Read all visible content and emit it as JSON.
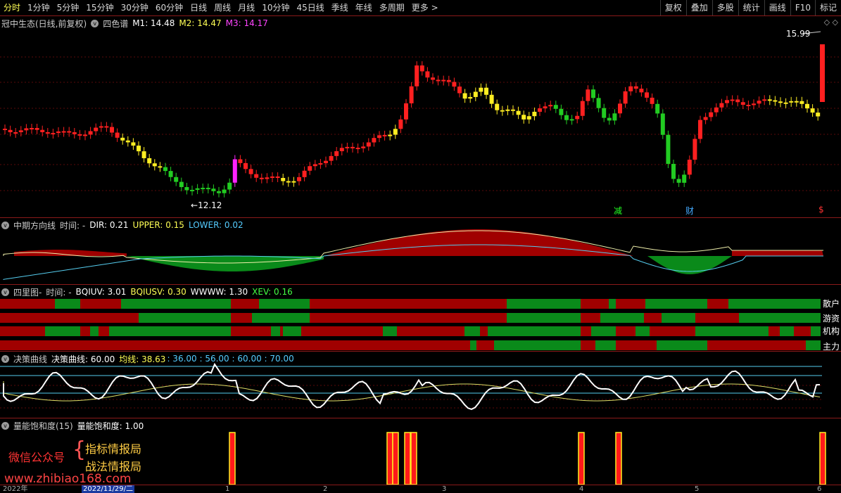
{
  "toolbar": {
    "periods": [
      "分时",
      "1分钟",
      "5分钟",
      "15分钟",
      "30分钟",
      "60分钟",
      "日线",
      "周线",
      "月线",
      "10分钟",
      "45日线",
      "季线",
      "年线",
      "多周期",
      "更多 >"
    ],
    "active_index": 0,
    "right_tools": [
      "复权",
      "叠加",
      "多股",
      "统计",
      "画线",
      "F10",
      "标记"
    ]
  },
  "main_panel": {
    "title": "冠中生态(日线,前复权)",
    "indicator": "四色谱",
    "m1": "M1: 14.48",
    "m2": "M2: 14.47",
    "m3": "M3: 14.17",
    "high_label": "15.99",
    "low_label": "12.12",
    "tags": [
      "减",
      "财",
      "$"
    ]
  },
  "dir_panel": {
    "title": "中期方向线",
    "time": "时间: -",
    "dir": "DIR: 0.21",
    "upper": "UPPER: 0.15",
    "lower": "LOWER: 0.02"
  },
  "four_panel": {
    "title": "四里图-",
    "time": "时间: -",
    "bqiuv": "BQIUV: 3.01",
    "bqiusv": "BQIUSV: 0.30",
    "www": "WWWW: 1.30",
    "xev": "XEV: 0.16",
    "rows": [
      "散户",
      "游资",
      "机构",
      "主力"
    ]
  },
  "decision_panel": {
    "title": "决策曲线",
    "name": "决策曲线: 60.00",
    "avg": "均线: 38.63",
    "levels": ": 36.00 : 56.00 : 60.00 : 70.00"
  },
  "energy_panel": {
    "title": "量能饱和度(15)",
    "value": "量能饱和度: 1.00"
  },
  "watermark": {
    "account": "微信公众号",
    "brand1": "指标情报局",
    "brand2": "战法情报局",
    "site": "www.zhibiao168.com"
  },
  "axis": {
    "year": "2022年",
    "date": "2022/11/29/二",
    "months": [
      "1",
      "2",
      "3",
      "4",
      "5",
      "6"
    ]
  },
  "colors": {
    "up": "#ff2020",
    "down": "#22cc22",
    "yellow": "#ffee22",
    "magenta": "#ff22ff",
    "darkred": "#a00000",
    "darkgreen": "#0a8a1a"
  }
}
